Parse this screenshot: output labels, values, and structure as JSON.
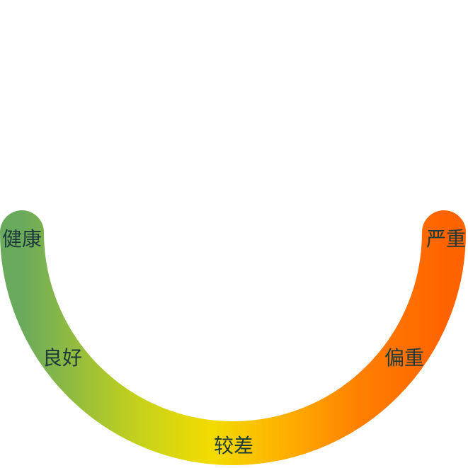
{
  "gauge": {
    "label_color": "#1c3a3a",
    "gradient": [
      "#6aaa5c",
      "#cfd416",
      "#f2dc00",
      "#ffb000",
      "#ff8000",
      "#ff6300"
    ],
    "labels": [
      {
        "text": "健康"
      },
      {
        "text": "良好"
      },
      {
        "text": "较差"
      },
      {
        "text": "偏重"
      },
      {
        "text": "严重"
      }
    ]
  }
}
